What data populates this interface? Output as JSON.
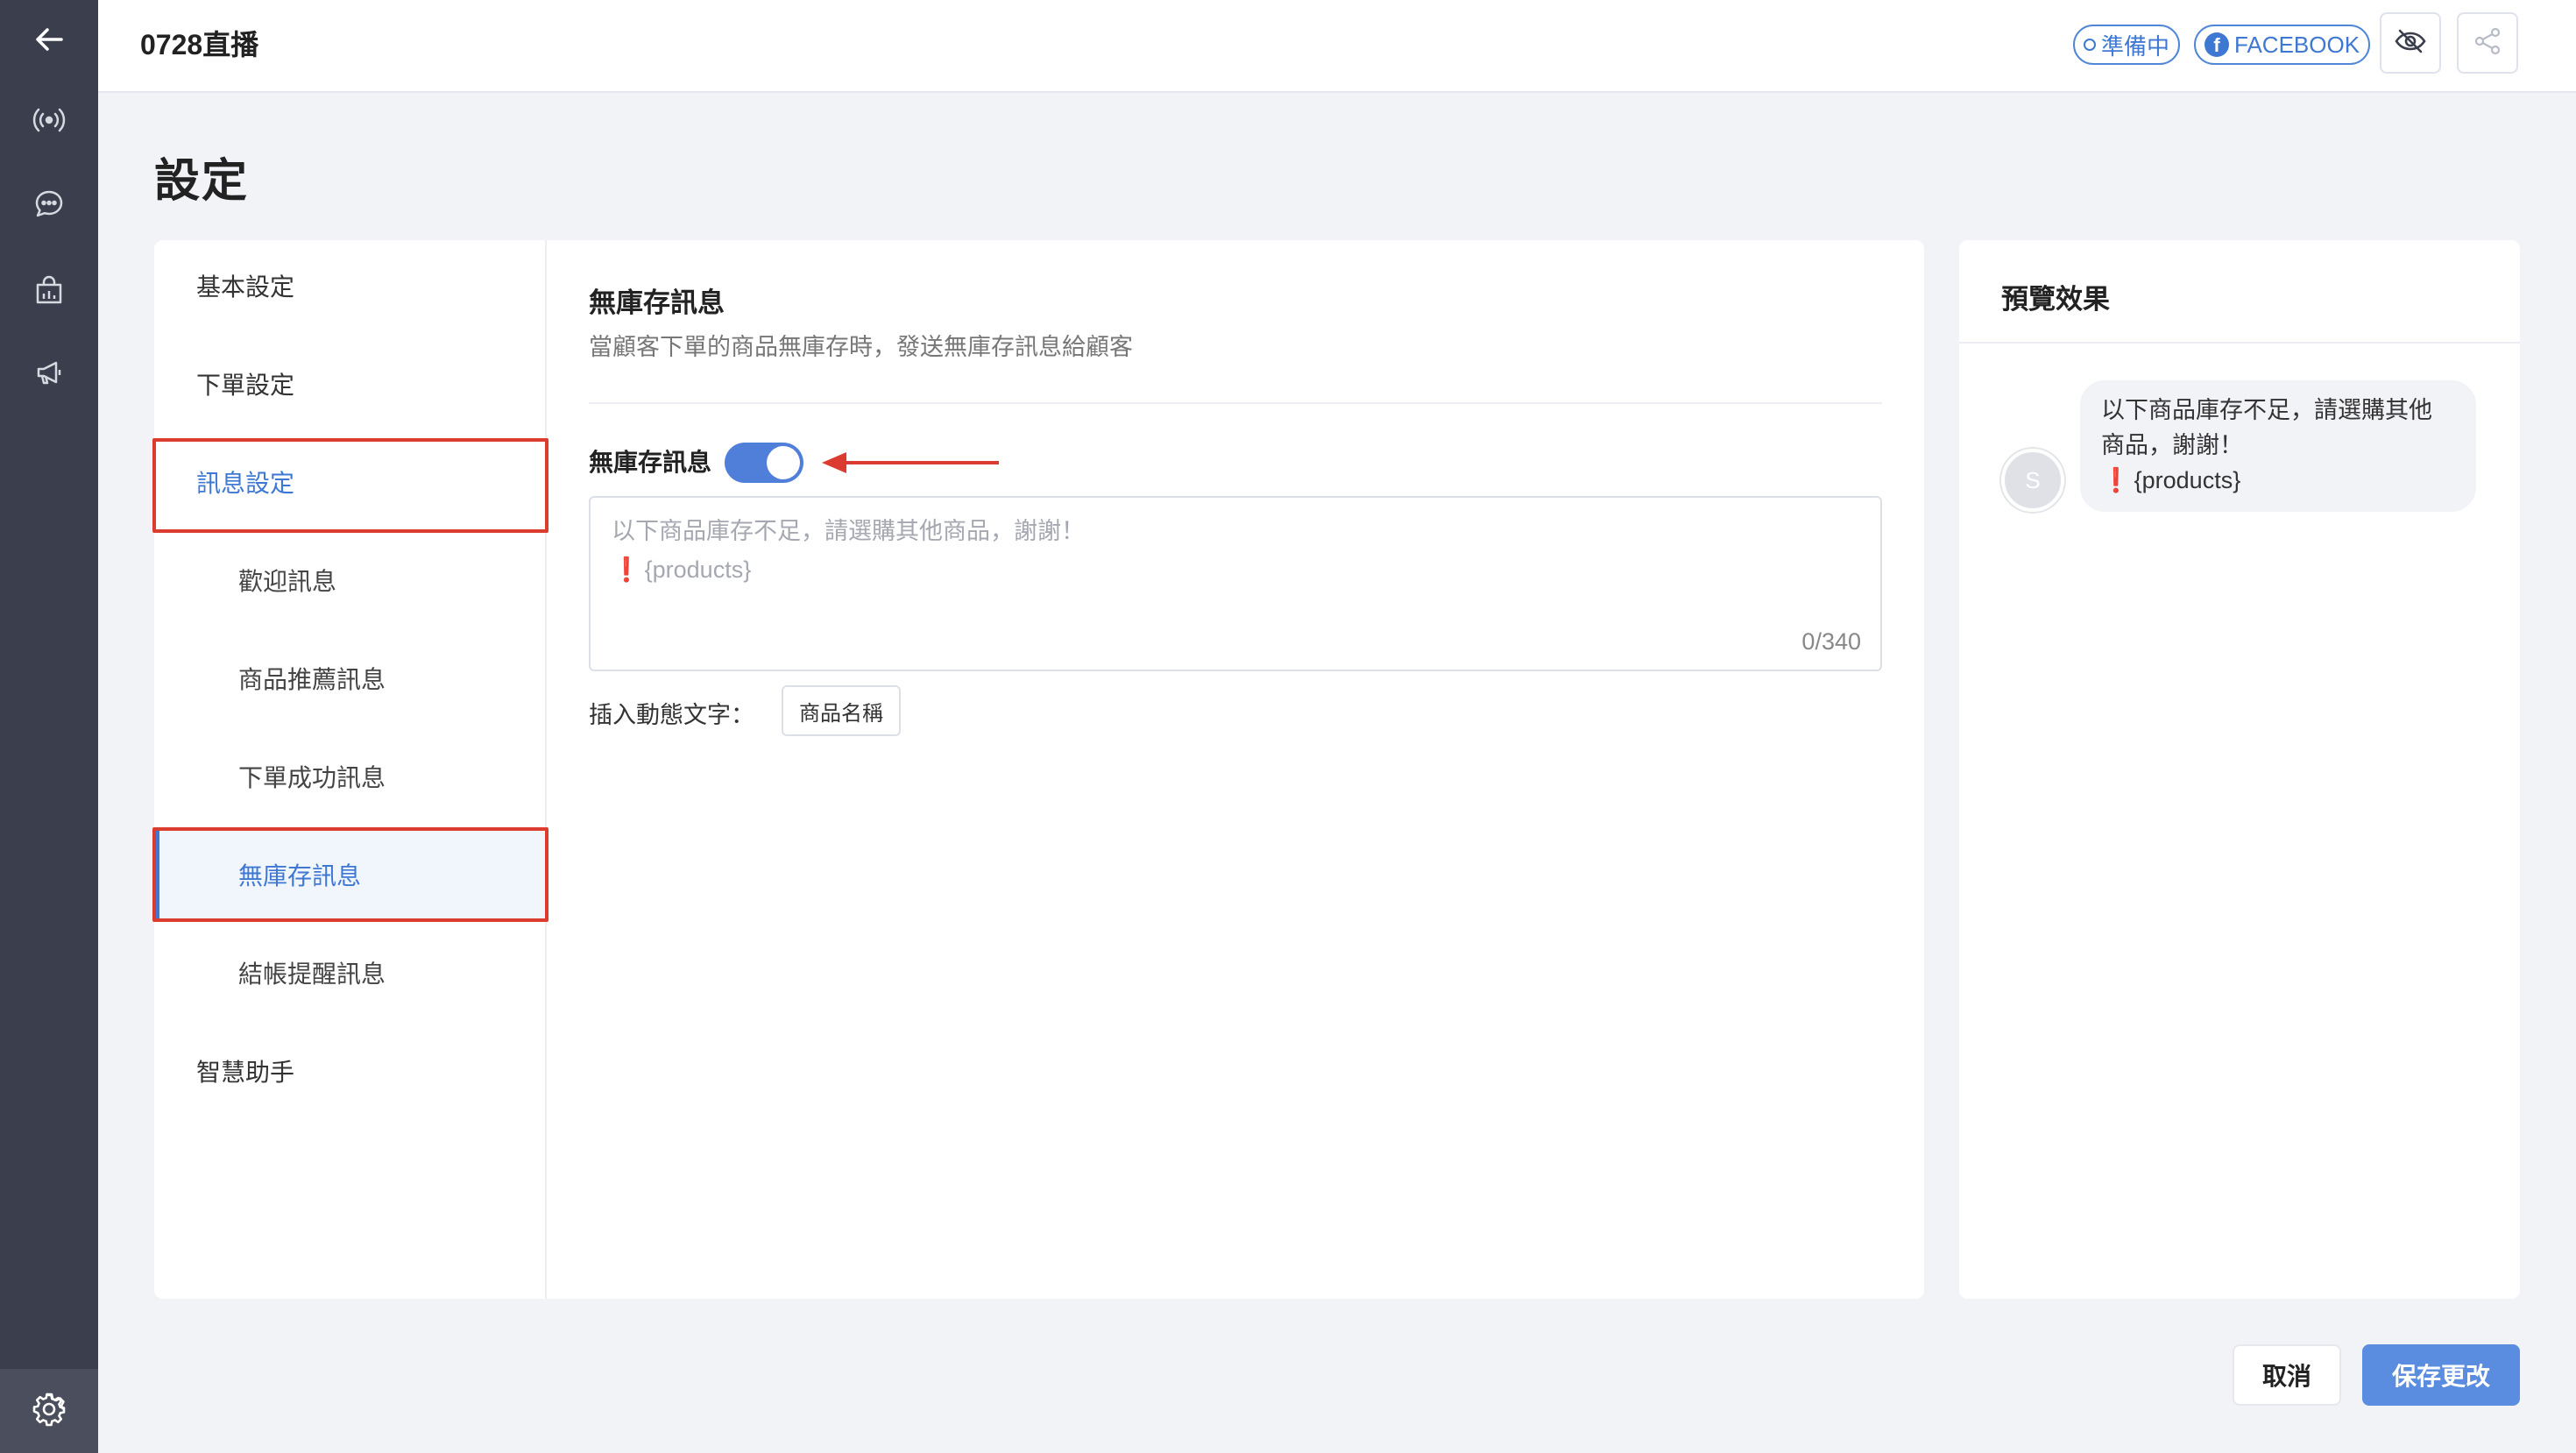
{
  "rail": {
    "icons": [
      "back-arrow-icon",
      "live-broadcast-icon",
      "chat-icon",
      "shop-icon",
      "megaphone-icon",
      "gear-icon"
    ]
  },
  "header": {
    "title": "0728直播",
    "status_label": "準備中",
    "platform_label": "FACEBOOK",
    "platform_icon_letter": "f"
  },
  "page": {
    "title": "設定"
  },
  "menu": {
    "items": [
      {
        "label": "基本設定"
      },
      {
        "label": "下單設定"
      },
      {
        "label": "訊息設定"
      },
      {
        "label": "歡迎訊息"
      },
      {
        "label": "商品推薦訊息"
      },
      {
        "label": "下單成功訊息"
      },
      {
        "label": "無庫存訊息"
      },
      {
        "label": "結帳提醒訊息"
      },
      {
        "label": "智慧助手"
      }
    ]
  },
  "section": {
    "title": "無庫存訊息",
    "description": "當顧客下單的商品無庫存時，發送無庫存訊息給顧客",
    "toggle_label": "無庫存訊息",
    "toggle_on": true,
    "textarea": {
      "line1": "以下商品庫存不足，請選購其他商品，謝謝！",
      "line2_mark": "❗",
      "line2": "{products}",
      "counter": "0/340"
    },
    "insert_label": "插入動態文字：",
    "insert_tag": "商品名稱"
  },
  "preview": {
    "title": "預覽效果",
    "avatar_letter": "S",
    "bubble_line1": "以下商品庫存不足，請選購其他",
    "bubble_line2": "商品，謝謝！",
    "bubble_line3_mark": "❗",
    "bubble_line3": "{products}"
  },
  "actions": {
    "cancel": "取消",
    "save": "保存更改"
  },
  "colors": {
    "accent": "#3f78d3",
    "save_button": "#5a8ce0",
    "highlight_box": "#dc3b2f",
    "rail": "#3b3e4c"
  }
}
